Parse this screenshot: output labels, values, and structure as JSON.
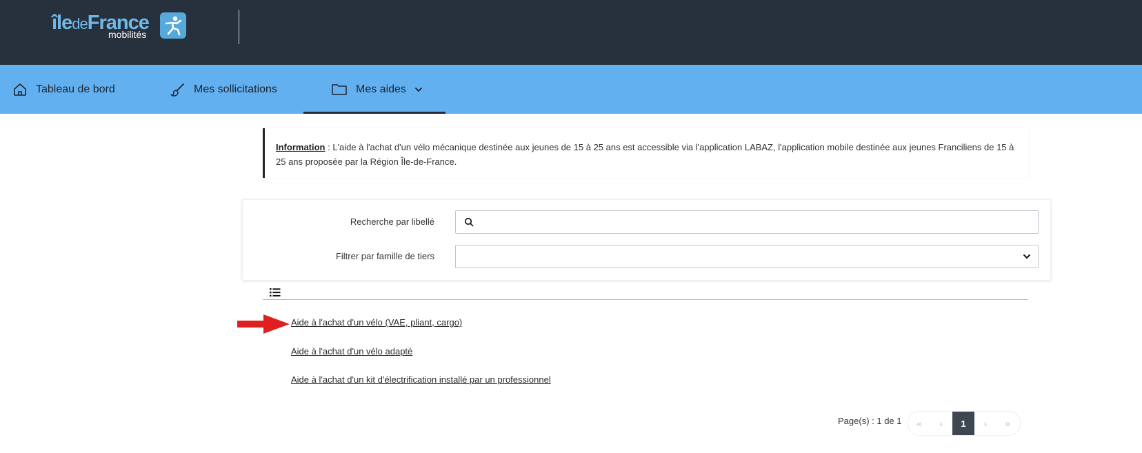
{
  "header": {
    "logo": {
      "text_ile": "île",
      "text_de": "de",
      "text_france": "France",
      "text_mobilites": "mobilités"
    }
  },
  "nav": {
    "items": [
      {
        "label": "Tableau de bord",
        "icon": "home-icon"
      },
      {
        "label": "Mes sollicitations",
        "icon": "brush-icon"
      },
      {
        "label": "Mes aides",
        "icon": "folder-icon",
        "active": true
      }
    ]
  },
  "info": {
    "label": "Information",
    "separator": " : ",
    "text": "L'aide à l'achat d'un vélo mécanique destinée aux jeunes de 15 à 25 ans est accessible via l'application LABAZ, l'application mobile destinée aux jeunes Franciliens de 15 à 25 ans proposée par la Région Île-de-France."
  },
  "filters": {
    "search_label": "Recherche par libellé",
    "search_value": "",
    "family_label": "Filtrer par famille de tiers",
    "family_value": ""
  },
  "aids": [
    {
      "label": "Aide à l'achat d'un vélo (VAE, pliant, cargo)"
    },
    {
      "label": "Aide à l'achat d'un vélo adapté"
    },
    {
      "label": "Aide à l'achat d'un kit d'électrification installé par un professionnel"
    }
  ],
  "pagination": {
    "text": "Page(s) : 1 de 1",
    "first": "«",
    "prev": "‹",
    "current": "1",
    "next": "›",
    "last": "»"
  },
  "colors": {
    "topbar": "#27313d",
    "navbar": "#63b0f0",
    "accent_arrow": "#e02020",
    "pager_current": "#3e4652"
  }
}
